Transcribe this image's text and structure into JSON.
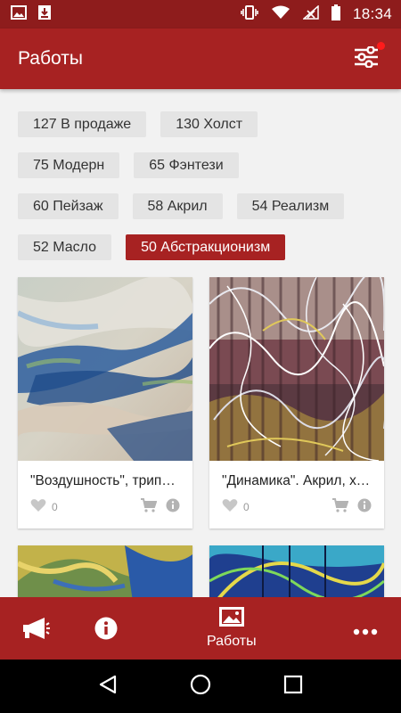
{
  "status_bar": {
    "time": "18:34",
    "icons": [
      "image-icon",
      "download-icon",
      "vibrate-icon",
      "wifi-icon",
      "signal-icon",
      "battery-icon"
    ]
  },
  "app_bar": {
    "title": "Работы",
    "filter_icon": "sliders-icon",
    "accent_color": "#a72222"
  },
  "filters": {
    "rows": [
      [
        {
          "label": "127 В продаже",
          "active": false
        },
        {
          "label": "130 Холст",
          "active": false
        }
      ],
      [
        {
          "label": "75 Модерн",
          "active": false
        },
        {
          "label": "65 Фэнтези",
          "active": false
        }
      ],
      [
        {
          "label": "60 Пейзаж",
          "active": false
        },
        {
          "label": "58 Акрил",
          "active": false
        },
        {
          "label": "54 Реализм",
          "active": false
        }
      ],
      [
        {
          "label": "52 Масло",
          "active": false
        },
        {
          "label": "50 Абстракционизм",
          "active": true
        }
      ]
    ]
  },
  "artworks": [
    {
      "title": "\"Воздушность\", триптих",
      "likes": "0"
    },
    {
      "title": "\"Динамика\". Акрил, холст",
      "likes": "0"
    }
  ],
  "bottom_nav": {
    "items": [
      {
        "icon": "megaphone-icon",
        "label": ""
      },
      {
        "icon": "info-icon",
        "label": ""
      },
      {
        "icon": "gallery-icon",
        "label": "Работы"
      },
      {
        "icon": "more-icon",
        "label": ""
      }
    ]
  }
}
